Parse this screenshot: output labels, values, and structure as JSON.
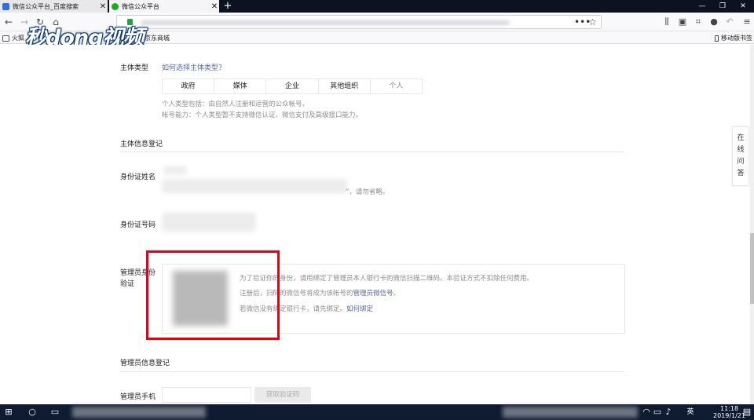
{
  "browser": {
    "tabs": [
      {
        "title": "微信公众平台_百度搜索",
        "close": "✕"
      },
      {
        "title": "微信公众平台",
        "close": "✕"
      }
    ],
    "new_tab": "+",
    "window_controls": {
      "minimize": "—",
      "restore": "❐",
      "close": "✕"
    },
    "url_actions": {
      "more": "•••",
      "star": "☆"
    },
    "bookmarks": [
      {
        "label": "火狐"
      },
      {
        "label": "京东商城"
      }
    ],
    "mobile_bookmarks": "移动版书签",
    "watermark": "秒dong视频"
  },
  "form": {
    "subject_type_label": "主体类型",
    "subject_type_link": "如何选择主体类型？",
    "subject_types": [
      "政府",
      "媒体",
      "企业",
      "其他组织",
      "个人"
    ],
    "subject_hint_1": "个人类型包括：由自然人注册和运营的公众帐号。",
    "subject_hint_2": "帐号能力：个人类型暂不支持微信认证、微信支付及高级接口能力。",
    "section_subject_info": "主体信息登记",
    "id_name_label": "身份证姓名",
    "id_name_hint": "”，请勿省略。",
    "id_number_label": "身份证号码",
    "admin_verify_label_1": "管理员身份",
    "admin_verify_label_2": "验证",
    "verify_line_1": "为了验证你的身份，请用绑定了管理员本人银行卡的微信扫描二维码。本验证方式不扣除任何费用。",
    "verify_line_2_prefix": "注册后，扫码的微信号将成为该帐号的",
    "verify_line_2_link": "管理员微信号",
    "verify_line_2_suffix": "。",
    "verify_line_3_prefix": "若微信没有绑定银行卡，请先绑定。",
    "verify_line_3_link": "如何绑定",
    "section_admin_info": "管理员信息登记",
    "admin_phone_label": "管理员手机",
    "get_code_button": "获取验证码"
  },
  "side_widget": {
    "chars": [
      "在",
      "线",
      "问",
      "答"
    ]
  },
  "taskbar": {
    "ime": "英",
    "time": "11:18",
    "date": "2019/1/21"
  }
}
